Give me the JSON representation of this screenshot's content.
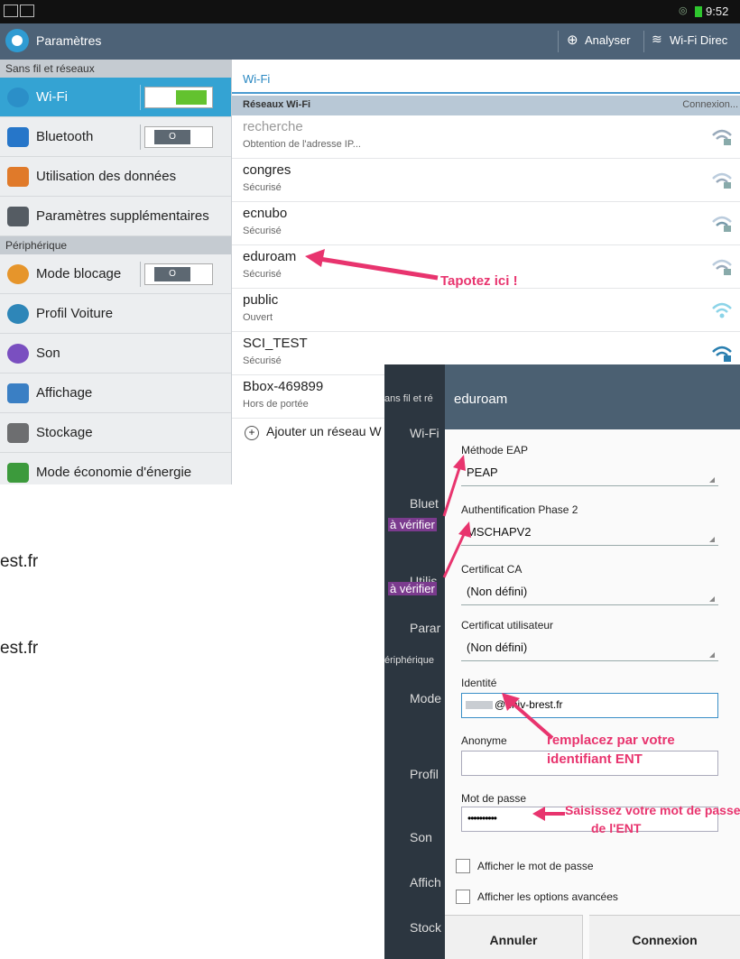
{
  "status_bar": {
    "time": "9:52"
  },
  "action_bar": {
    "title": "Paramètres",
    "scan_label": "Analyser",
    "wifi_direct_label": "Wi-Fi Direc"
  },
  "sidebar": {
    "section1": "Sans fil et réseaux",
    "section2": "Périphérique",
    "items": [
      {
        "label": "Wi-Fi"
      },
      {
        "label": "Bluetooth",
        "toggle": "O"
      },
      {
        "label": "Utilisation des données"
      },
      {
        "label": "Paramètres supplémentaires"
      },
      {
        "label": "Mode blocage",
        "toggle": "O"
      },
      {
        "label": "Profil Voiture"
      },
      {
        "label": "Son"
      },
      {
        "label": "Affichage"
      },
      {
        "label": "Stockage"
      },
      {
        "label": "Mode économie d'énergie"
      }
    ]
  },
  "main": {
    "title": "Wi-Fi",
    "header_left": "Réseaux Wi-Fi",
    "header_right": "Connexion...",
    "networks": [
      {
        "name": "recherche",
        "status": "Obtention de l'adresse IP..."
      },
      {
        "name": "congres",
        "status": "Sécurisé"
      },
      {
        "name": "ecnubo",
        "status": "Sécurisé"
      },
      {
        "name": "eduroam",
        "status": "Sécurisé"
      },
      {
        "name": "public",
        "status": "Ouvert"
      },
      {
        "name": "SCI_TEST",
        "status": "Sécurisé"
      },
      {
        "name": "Bbox-469899",
        "status": "Hors de portée"
      }
    ],
    "add_network": "Ajouter un réseau W"
  },
  "behind_text": {
    "line1": "est.fr",
    "line2": "est.fr"
  },
  "annotations": {
    "tap_here": "Tapotez ici !",
    "verify1": "à vérifier",
    "verify2": "à vérifier",
    "replace_line1": "remplacez par votre",
    "replace_line2": "identifiant ENT",
    "password_line1": "Saisissez votre mot de passe",
    "password_line2": "de l'ENT"
  },
  "overlay_left": {
    "header": "ans fil et ré",
    "items": [
      "Wi-Fi",
      "Bluet",
      "Utilis",
      "Parar",
      "ériphérique",
      "Mode",
      "O",
      "Profil",
      "Son",
      "Affich",
      "Stock"
    ]
  },
  "dialog": {
    "title": "eduroam",
    "eap_label": "Méthode EAP",
    "eap_value": "PEAP",
    "phase2_label": "Authentification Phase 2",
    "phase2_value": "MSCHAPV2",
    "ca_label": "Certificat CA",
    "ca_value": "(Non défini)",
    "user_cert_label": "Certificat utilisateur",
    "user_cert_value": "(Non défini)",
    "identity_label": "Identité",
    "identity_value": "@univ-brest.fr",
    "anonymous_label": "Anonyme",
    "anonymous_value": "",
    "password_label": "Mot de passe",
    "password_value": "••••••••••",
    "show_password_label": "Afficher le mot de passe",
    "advanced_label": "Afficher les options avancées",
    "cancel_label": "Annuler",
    "connect_label": "Connexion"
  },
  "colors": {
    "accent": "#34a3d3",
    "annotation": "#e8346e",
    "action_bar": "#4d6277"
  }
}
